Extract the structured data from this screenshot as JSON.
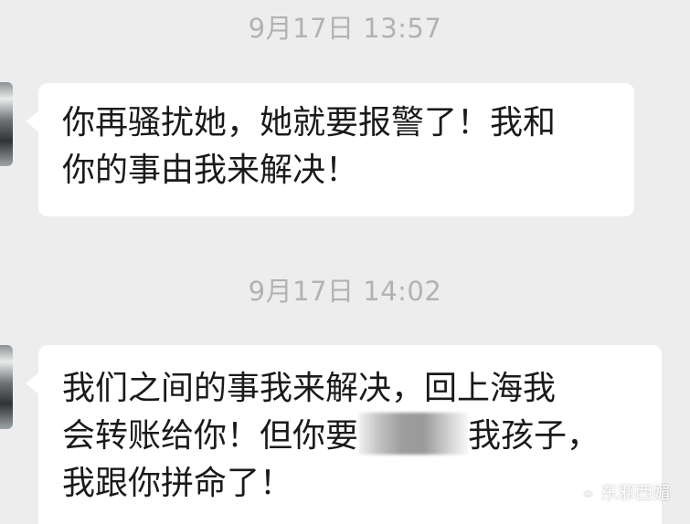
{
  "chat": {
    "messages": [
      {
        "timestamp": "9月17日 13:57",
        "lines": [
          "你再骚扰她，她就要报警了！我和",
          "你的事由我来解决！"
        ]
      },
      {
        "timestamp": "9月17日 14:02",
        "lines": [
          "我们之间的事我来解决，回上海我",
          "会转账给你！但你要",
          "我孩子，",
          "我跟你拼命了！"
        ]
      }
    ]
  },
  "watermark": {
    "text": "东邪西媚",
    "icon": "wechat-official-account-icon",
    "color": "#ffffff"
  },
  "colors": {
    "background": "#ededed",
    "bubble": "#ffffff",
    "timestamp": "#b2b2b2",
    "text": "#1a1a1a"
  }
}
